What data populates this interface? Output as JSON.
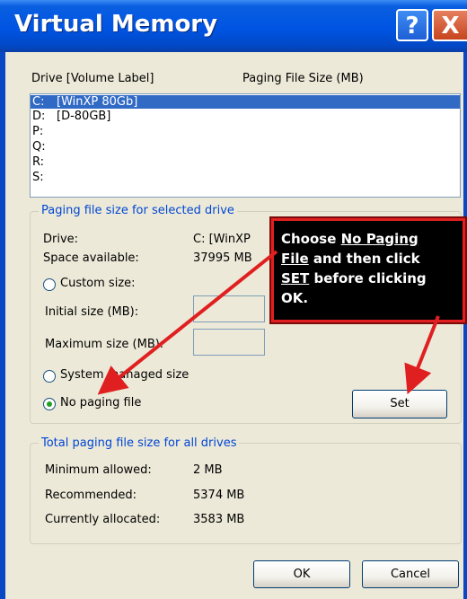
{
  "window": {
    "title": "Virtual Memory",
    "help_label": "?",
    "close_label": "X"
  },
  "drive_list": {
    "header_drive": "Drive  [Volume Label]",
    "header_paging": "Paging File Size (MB)",
    "rows": [
      {
        "drive": "C:",
        "label": "[WinXP 80Gb]",
        "selected": true
      },
      {
        "drive": "D:",
        "label": "[D-80GB]",
        "selected": false
      },
      {
        "drive": "P:",
        "label": "",
        "selected": false
      },
      {
        "drive": "Q:",
        "label": "",
        "selected": false
      },
      {
        "drive": "R:",
        "label": "",
        "selected": false
      },
      {
        "drive": "S:",
        "label": "",
        "selected": false
      }
    ]
  },
  "selected_drive": {
    "group_title": "Paging file size for selected drive",
    "drive_label": "Drive:",
    "drive_value": "C:  [WinXP",
    "space_label": "Space available:",
    "space_value": "37995 MB",
    "custom_size": "Custom size:",
    "initial_size": "Initial size (MB):",
    "maximum_size": "Maximum size (MB):",
    "system_managed": "System managed size",
    "no_paging": "No paging file",
    "selected_option": "no_paging",
    "set_label": "Set"
  },
  "totals": {
    "group_title": "Total paging file size for all drives",
    "minimum_label": "Minimum allowed:",
    "minimum_value": "2 MB",
    "recommended_label": "Recommended:",
    "recommended_value": "5374 MB",
    "allocated_label": "Currently allocated:",
    "allocated_value": "3583 MB"
  },
  "buttons": {
    "ok": "OK",
    "cancel": "Cancel"
  },
  "annotation": {
    "line1_prefix": "Choose ",
    "line1_link": "No Paging",
    "line2_link": "File",
    "line2_rest": " and then click",
    "line3_link": "SET",
    "line3_rest": " before clicking",
    "line4": "OK."
  },
  "colors": {
    "title_bar": "#0054e3",
    "selection": "#316ac5",
    "group_title": "#0046d5",
    "callout_border": "#e02020",
    "arrow": "#e02020"
  }
}
